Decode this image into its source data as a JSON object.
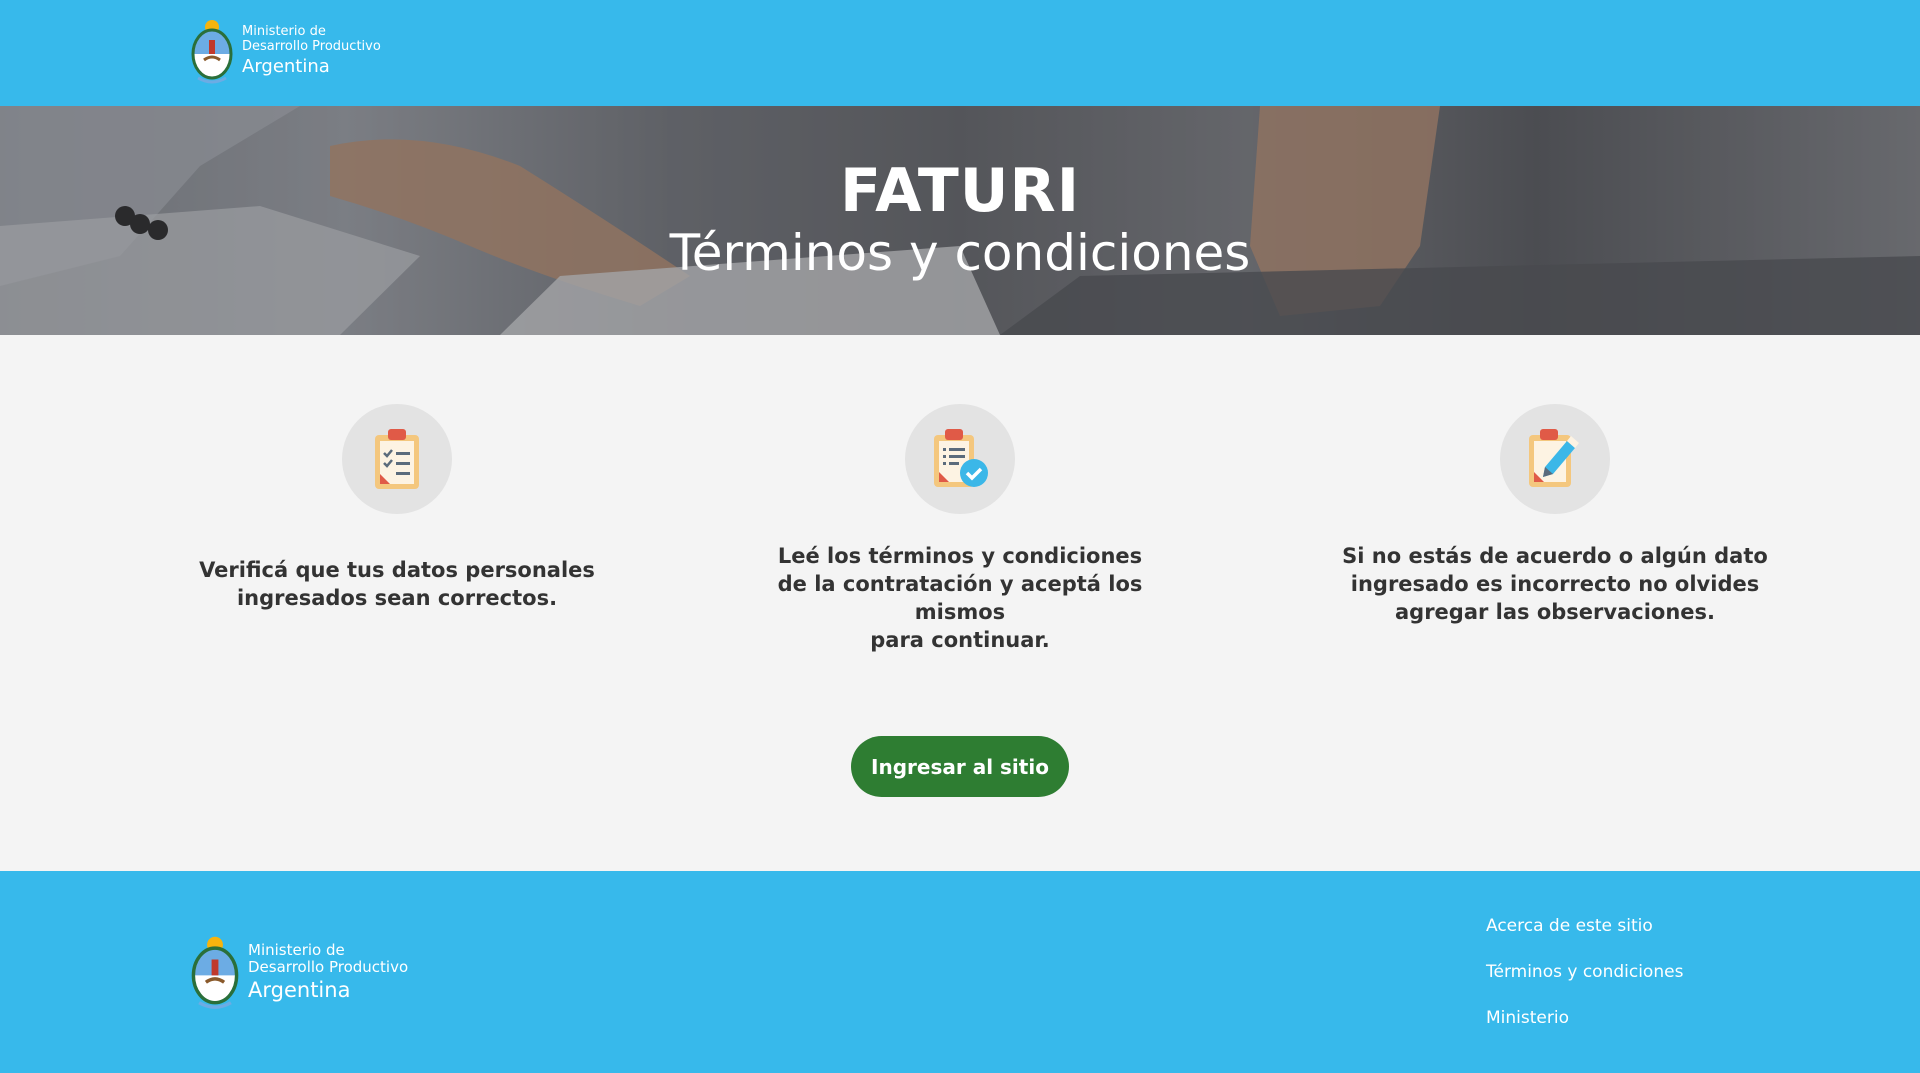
{
  "header": {
    "logo": {
      "line1": "Ministerio de",
      "line2": "Desarrollo Productivo",
      "line3": "Argentina"
    }
  },
  "hero": {
    "title": "FATURI",
    "subtitle": "Términos y condiciones"
  },
  "steps": [
    {
      "icon": "checklist-clipboard-icon",
      "text_lines": [
        "Verificá que tus datos personales",
        "ingresados sean correctos."
      ]
    },
    {
      "icon": "clipboard-check-icon",
      "text_lines": [
        "Leé los términos y condiciones",
        "de la contratación y aceptá los mismos",
        "para continuar."
      ]
    },
    {
      "icon": "clipboard-edit-icon",
      "text_lines": [
        "Si no estás de acuerdo o algún dato",
        "ingresado es incorrecto no olvides",
        "agregar las observaciones."
      ]
    }
  ],
  "button": {
    "label": "Ingresar al sitio"
  },
  "footer": {
    "logo": {
      "line1": "Ministerio de",
      "line2": "Desarrollo Productivo",
      "line3": "Argentina"
    },
    "links": [
      "Acerca de este sitio",
      "Términos y condiciones",
      "Ministerio"
    ]
  },
  "colors": {
    "brand_blue": "#37b9eb",
    "button_green": "#2e7d32",
    "background": "#f4f4f4"
  }
}
